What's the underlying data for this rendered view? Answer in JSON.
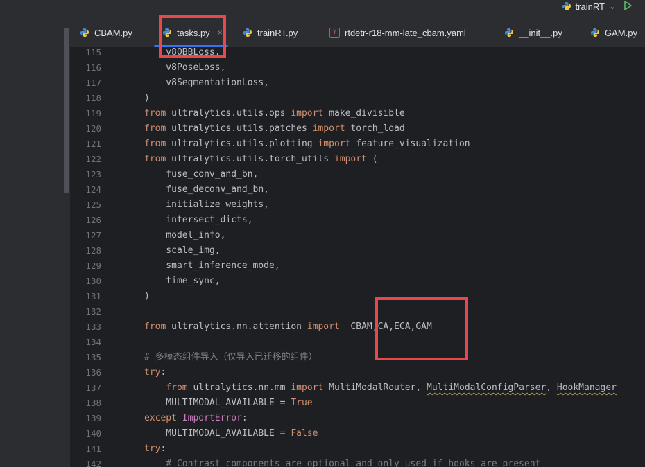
{
  "run_config": {
    "label": "trainRT",
    "dropdown": "⌄"
  },
  "tabs": [
    {
      "label": "CBAM.py",
      "icon": "python-file-icon"
    },
    {
      "label": "tasks.py",
      "icon": "python-file-icon",
      "active": true,
      "close": "×"
    },
    {
      "label": "trainRT.py",
      "icon": "python-file-icon"
    },
    {
      "label": "rtdetr-r18-mm-late_cbam.yaml",
      "icon": "yaml-file-icon",
      "icon_text": "Y"
    },
    {
      "label": "__init__.py",
      "icon": "python-file-icon"
    },
    {
      "label": "GAM.py",
      "icon": "python-file-icon"
    }
  ],
  "code": {
    "lines": [
      {
        "n": "115",
        "t": "    v8OBBLoss,"
      },
      {
        "n": "116",
        "t": "    v8PoseLoss,"
      },
      {
        "n": "117",
        "t": "    v8SegmentationLoss,"
      },
      {
        "n": "118",
        "t": ")"
      },
      {
        "n": "119",
        "t": "from ultralytics.utils.ops import make_divisible"
      },
      {
        "n": "120",
        "t": "from ultralytics.utils.patches import torch_load"
      },
      {
        "n": "121",
        "t": "from ultralytics.utils.plotting import feature_visualization"
      },
      {
        "n": "122",
        "t": "from ultralytics.utils.torch_utils import ("
      },
      {
        "n": "123",
        "t": "    fuse_conv_and_bn,"
      },
      {
        "n": "124",
        "t": "    fuse_deconv_and_bn,"
      },
      {
        "n": "125",
        "t": "    initialize_weights,"
      },
      {
        "n": "126",
        "t": "    intersect_dicts,"
      },
      {
        "n": "127",
        "t": "    model_info,"
      },
      {
        "n": "128",
        "t": "    scale_img,"
      },
      {
        "n": "129",
        "t": "    smart_inference_mode,"
      },
      {
        "n": "130",
        "t": "    time_sync,"
      },
      {
        "n": "131",
        "t": ")"
      },
      {
        "n": "132",
        "t": ""
      },
      {
        "n": "133",
        "t": "from ultralytics.nn.attention import  CBAM,CA,ECA,GAM"
      },
      {
        "n": "134",
        "t": ""
      },
      {
        "n": "135",
        "t": "# 多模态组件导入（仅导入已迁移的组件）"
      },
      {
        "n": "136",
        "t": "try:"
      },
      {
        "n": "137",
        "t": "    from ultralytics.nn.mm import MultiModalRouter, MultiModalConfigParser, HookManager"
      },
      {
        "n": "138",
        "t": "    MULTIMODAL_AVAILABLE = True"
      },
      {
        "n": "139",
        "t": "except ImportError:"
      },
      {
        "n": "140",
        "t": "    MULTIMODAL_AVAILABLE = False"
      },
      {
        "n": "141",
        "t": "try:"
      },
      {
        "n": "142",
        "t": "    # Contrast components are optional and only used if hooks are present"
      }
    ]
  },
  "colors": {
    "keyword": "#cf8e6d",
    "identifier": "#bcbec4",
    "comment": "#7a7e85",
    "builtin_class": "#c77dbb",
    "annotation_box": "#e5484d",
    "tab_underline": "#3574f0"
  }
}
